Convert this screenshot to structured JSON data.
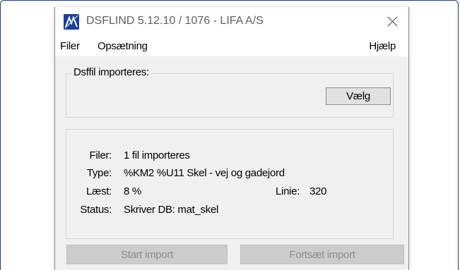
{
  "window": {
    "title": "DSFLIND 5.12.10 / 1076 - LIFA A/S"
  },
  "menu": {
    "filer": "Filer",
    "opsaetning": "Opsætning",
    "hjaelp": "Hjælp"
  },
  "import_group": {
    "legend": "Dsffil importeres:",
    "choose_button": "Vælg"
  },
  "status_panel": {
    "files_label": "Filer:",
    "files_value": "1 fil importeres",
    "type_label": "Type:",
    "type_value": "%KM2 %U11 Skel - vej og gadejord",
    "read_label": "Læst:",
    "read_value": "8 %",
    "line_label": "Linie:",
    "line_value": "320",
    "status_label": "Status:",
    "status_value": "Skriver DB: mat_skel"
  },
  "actions": {
    "start_import": "Start import",
    "continue_import": "Fortsæt import"
  },
  "colors": {
    "frame_accent": "#1f3b82",
    "window_bg": "#f0f0f0",
    "disabled_button": "#cccccc",
    "disabled_text": "#8d8d8d"
  }
}
